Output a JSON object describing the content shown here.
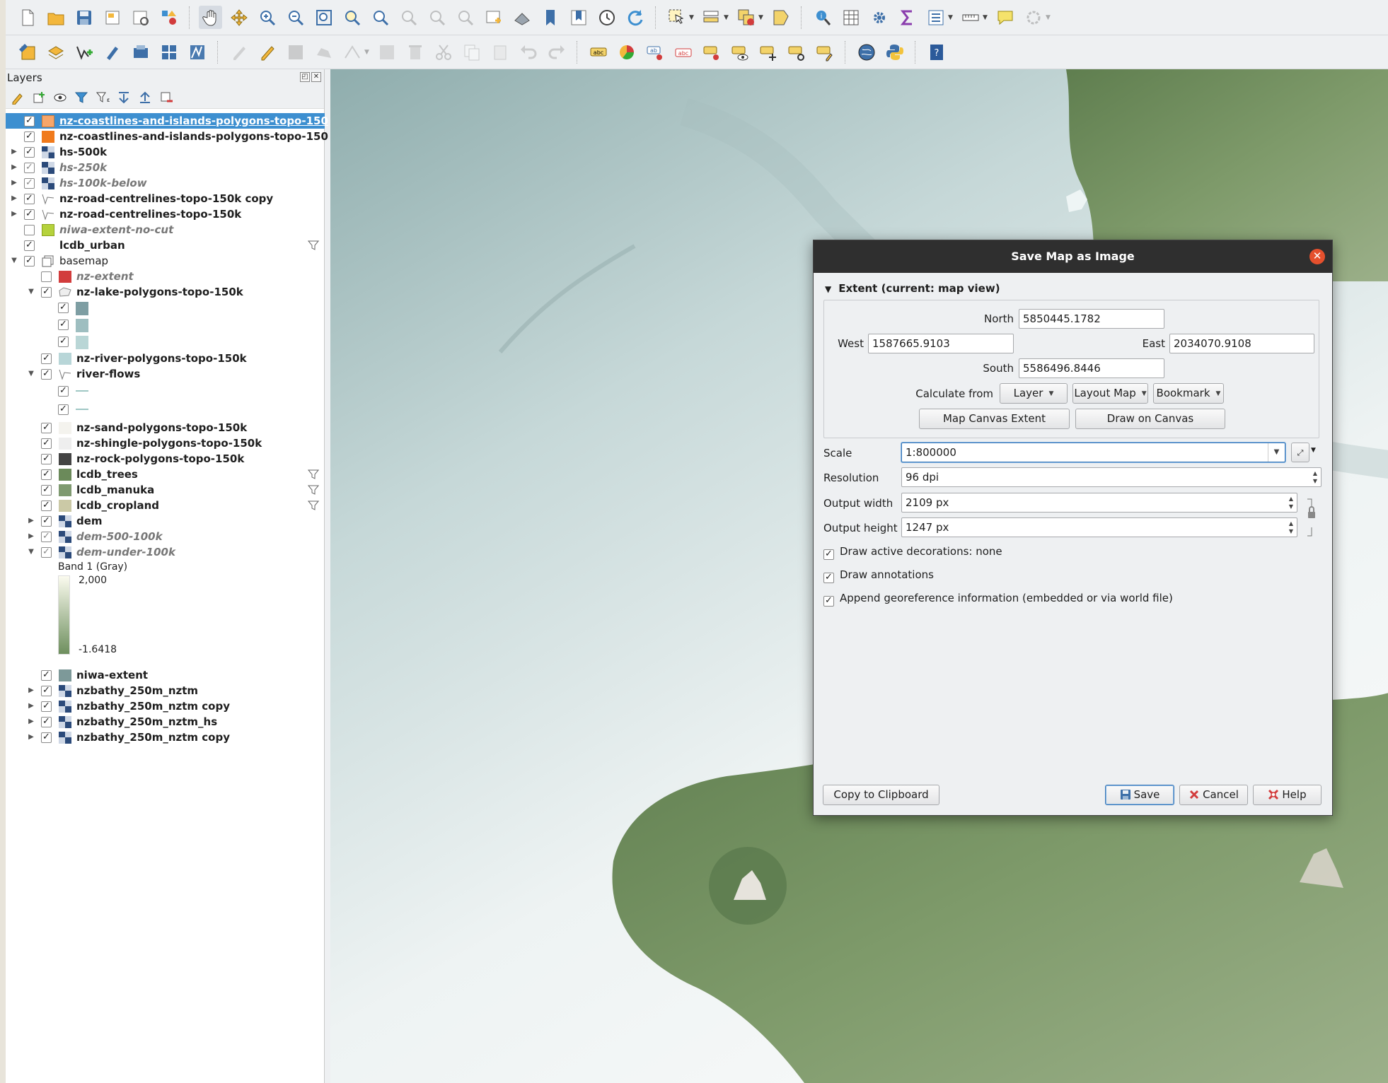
{
  "layers_panel": {
    "title": "Layers",
    "legend": {
      "band": "Band 1 (Gray)",
      "max": "2,000",
      "min": "-1.6418"
    },
    "rows": [
      "nz-coastlines-and-islands-polygons-topo-150",
      "nz-coastlines-and-islands-polygons-topo-150",
      "hs-500k",
      "hs-250k",
      "hs-100k-below",
      "nz-road-centrelines-topo-150k copy",
      "nz-road-centrelines-topo-150k",
      "niwa-extent-no-cut",
      "lcdb_urban",
      "basemap",
      "nz-extent",
      "nz-lake-polygons-topo-150k",
      "nz-river-polygons-topo-150k",
      "river-flows",
      "nz-sand-polygons-topo-150k",
      "nz-shingle-polygons-topo-150k",
      "nz-rock-polygons-topo-150k",
      "lcdb_trees",
      "lcdb_manuka",
      "lcdb_cropland",
      "dem",
      "dem-500-100k",
      "dem-under-100k",
      "niwa-extent",
      "nzbathy_250m_nztm",
      "nzbathy_250m_nztm copy",
      "nzbathy_250m_nztm_hs",
      "nzbathy_250m_nztm copy"
    ]
  },
  "colors": {
    "selection": "#3d8fd0",
    "coast_fill": "#f7a66a",
    "coast_orange": "#f07a1c",
    "niwa_no_cut": "#b5d23c",
    "nz_extent": "#d23c3c",
    "lake1": "#7e9ea3",
    "lake2": "#9ebec0",
    "lake3": "#b9d6d6",
    "river_poly": "#b8d6d8",
    "river_flow": "#9fc7c4",
    "sand": "#f4f3ee",
    "shingle": "#eeeeee",
    "rock": "#444444",
    "trees": "#6b8a5a",
    "manuka": "#7f9a70",
    "cropland": "#cbc9a6",
    "niwa_extent": "#7d9999"
  },
  "dialog": {
    "title": "Save Map as Image",
    "extent_header": "Extent (current: map view)",
    "north_label": "North",
    "north_value": "5850445.1782",
    "west_label": "West",
    "west_value": "1587665.9103",
    "east_label": "East",
    "east_value": "2034070.9108",
    "south_label": "South",
    "south_value": "5586496.8446",
    "calc_from_label": "Calculate from",
    "layer_btn": "Layer",
    "layout_map_btn": "Layout Map",
    "bookmark_btn": "Bookmark",
    "map_canvas_extent_btn": "Map Canvas Extent",
    "draw_on_canvas_btn": "Draw on Canvas",
    "scale_label": "Scale",
    "scale_value": "1:800000",
    "resolution_label": "Resolution",
    "resolution_value": "96 dpi",
    "width_label": "Output width",
    "width_value": "2109 px",
    "height_label": "Output height",
    "height_value": "1247 px",
    "chk_decorations": "Draw active decorations: none",
    "chk_annotations": "Draw annotations",
    "chk_georef": "Append georeference information (embedded or via world file)",
    "copy_btn": "Copy to Clipboard",
    "save_btn": "Save",
    "cancel_btn": "Cancel",
    "help_btn": "Help"
  }
}
